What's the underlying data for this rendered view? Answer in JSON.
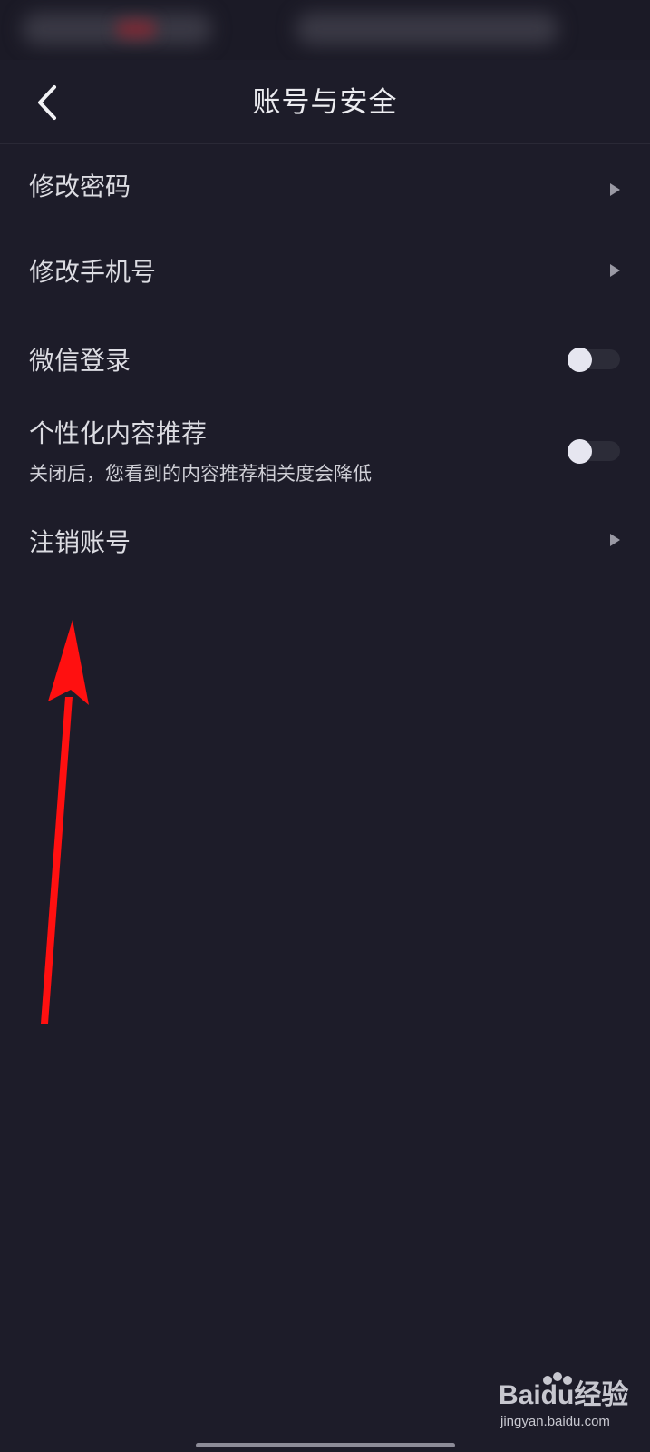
{
  "header": {
    "title": "账号与安全",
    "back_icon": "chevron-left-icon"
  },
  "settings": {
    "change_password": {
      "label": "修改密码",
      "icon": "triangle-right-icon"
    },
    "change_phone": {
      "label": "修改手机号",
      "icon": "triangle-right-icon"
    },
    "wechat_login": {
      "label": "微信登录",
      "enabled": false
    },
    "personalized": {
      "label": "个性化内容推荐",
      "description": "关闭后，您看到的内容推荐相关度会降低",
      "enabled": false
    },
    "delete_account": {
      "label": "注销账号",
      "icon": "triangle-right-icon"
    }
  },
  "watermark": {
    "logo": "Baidu经验",
    "url": "jingyan.baidu.com"
  },
  "colors": {
    "background": "#1d1c29",
    "text": "#dcdce2",
    "chevron": "#9a99a4",
    "toggle_track": "#2c2c38",
    "toggle_knob": "#e6e6f0",
    "annotation": "#ff1010"
  }
}
